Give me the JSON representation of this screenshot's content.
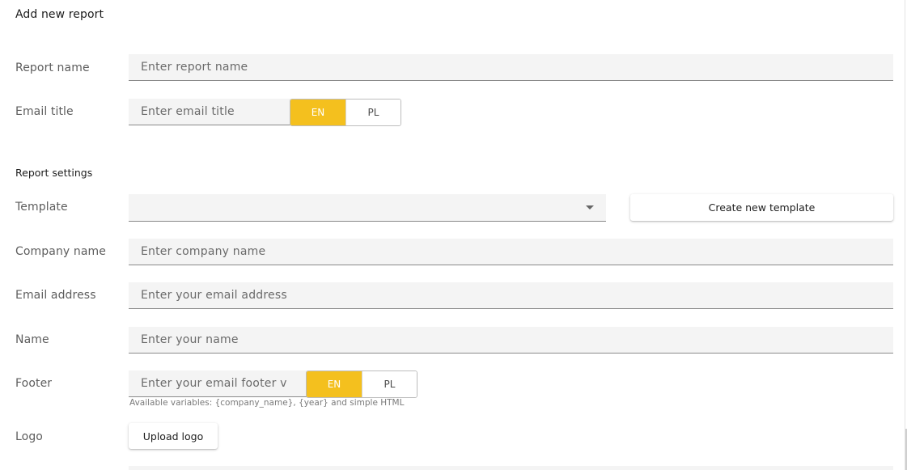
{
  "page_title": "Add new report",
  "report_name": {
    "label": "Report name",
    "placeholder": "Enter report name",
    "value": ""
  },
  "email_title": {
    "label": "Email title",
    "placeholder": "Enter email title",
    "value": "",
    "languages": [
      "EN",
      "PL"
    ],
    "selected_language": "EN"
  },
  "report_settings": {
    "heading": "Report settings",
    "template": {
      "label": "Template",
      "value": "",
      "create_button_label": "Create new template"
    },
    "company_name": {
      "label": "Company name",
      "placeholder": "Enter company name",
      "value": ""
    },
    "email_address": {
      "label": "Email address",
      "placeholder": "Enter your email address",
      "value": ""
    },
    "name": {
      "label": "Name",
      "placeholder": "Enter your name",
      "value": ""
    },
    "footer": {
      "label": "Footer",
      "placeholder": "Enter your email footer v",
      "value": "",
      "languages": [
        "EN",
        "PL"
      ],
      "selected_language": "EN",
      "hint": "Available variables: {company_name}, {year} and simple HTML"
    },
    "logo": {
      "label": "Logo",
      "upload_button_label": "Upload logo"
    }
  },
  "colors": {
    "accent": "#f4c01e",
    "field_background": "#f4f4f4",
    "label_text": "#5d5d5d"
  }
}
